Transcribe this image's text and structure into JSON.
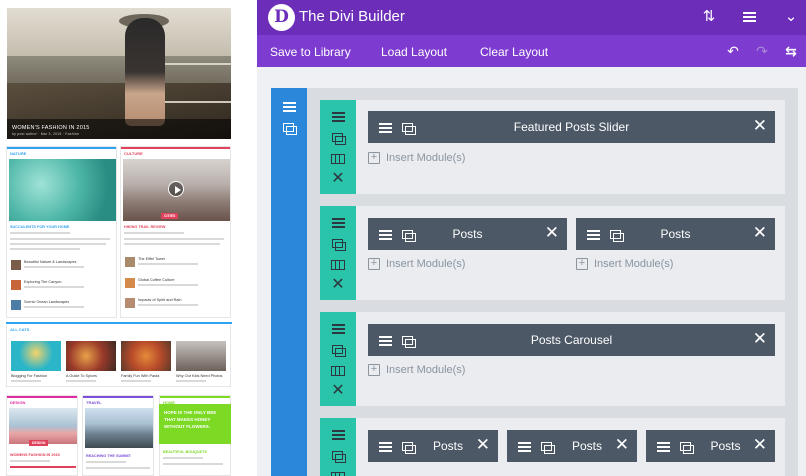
{
  "preview": {
    "hero_caption": "WOMEN'S FASHION IN 2015",
    "hero_sub": "by post author · Mar 3, 2015 · Fashion",
    "col1_head": "NATURE",
    "col2_head": "CULTURE",
    "col1_title": "SUCCULENTS FOR YOUR HOME",
    "col2_title": "HIKING TRAIL REVIEW",
    "col2_badge": "CITIES",
    "col1_items": [
      "Beautiful Nature & Landscapes",
      "Exploring The Canyon",
      "Scenic Ocean Landscapes"
    ],
    "col2_items": [
      "The Eiffel Tower",
      "Global Coffee Culture",
      "Impacts of Spirit and Rain"
    ],
    "all_head": "ALL CATS",
    "all_items": [
      "Blogging For Fashion",
      "A Guide To Spices",
      "Family Fun With Pasta",
      "Why Our Kids Need Photos"
    ],
    "design_head": "DESIGN",
    "travel_head": "TRAVEL",
    "home_head": "HOME",
    "design_badge": "DESIGN",
    "design_title": "WOMENS FASHION IN 2015",
    "travel_title": "REACHING THE SUMMIT",
    "promo_text": "HOPE IS THE ONLY BEE THAT MAKES HONEY WITHOUT FLOWERS.",
    "home_title": "BEAUTIFUL BOUQUETS"
  },
  "builder": {
    "logo_letter": "D",
    "title": "The Divi Builder",
    "topbar_icons": [
      "sort-icon",
      "menu-icon",
      "chevron-down-icon"
    ],
    "subbar": {
      "save": "Save to Library",
      "load": "Load Layout",
      "clear": "Clear Layout"
    },
    "subbar_icons": [
      "undo-icon",
      "redo-icon",
      "portability-icon"
    ],
    "insert_label": "Insert Module(s)",
    "rows": [
      {
        "modules": [
          "Featured Posts Slider"
        ]
      },
      {
        "modules": [
          "Posts",
          "Posts"
        ]
      },
      {
        "modules": [
          "Posts Carousel"
        ]
      },
      {
        "modules": [
          "Posts",
          "Posts",
          "Posts"
        ]
      }
    ]
  },
  "colors": {
    "topbar": "#6c2eb9",
    "subbar": "#7e3bd0",
    "section": "#2b87da",
    "row": "#29c4a9",
    "module": "#4c5866",
    "canvas": "#d9dde2"
  }
}
